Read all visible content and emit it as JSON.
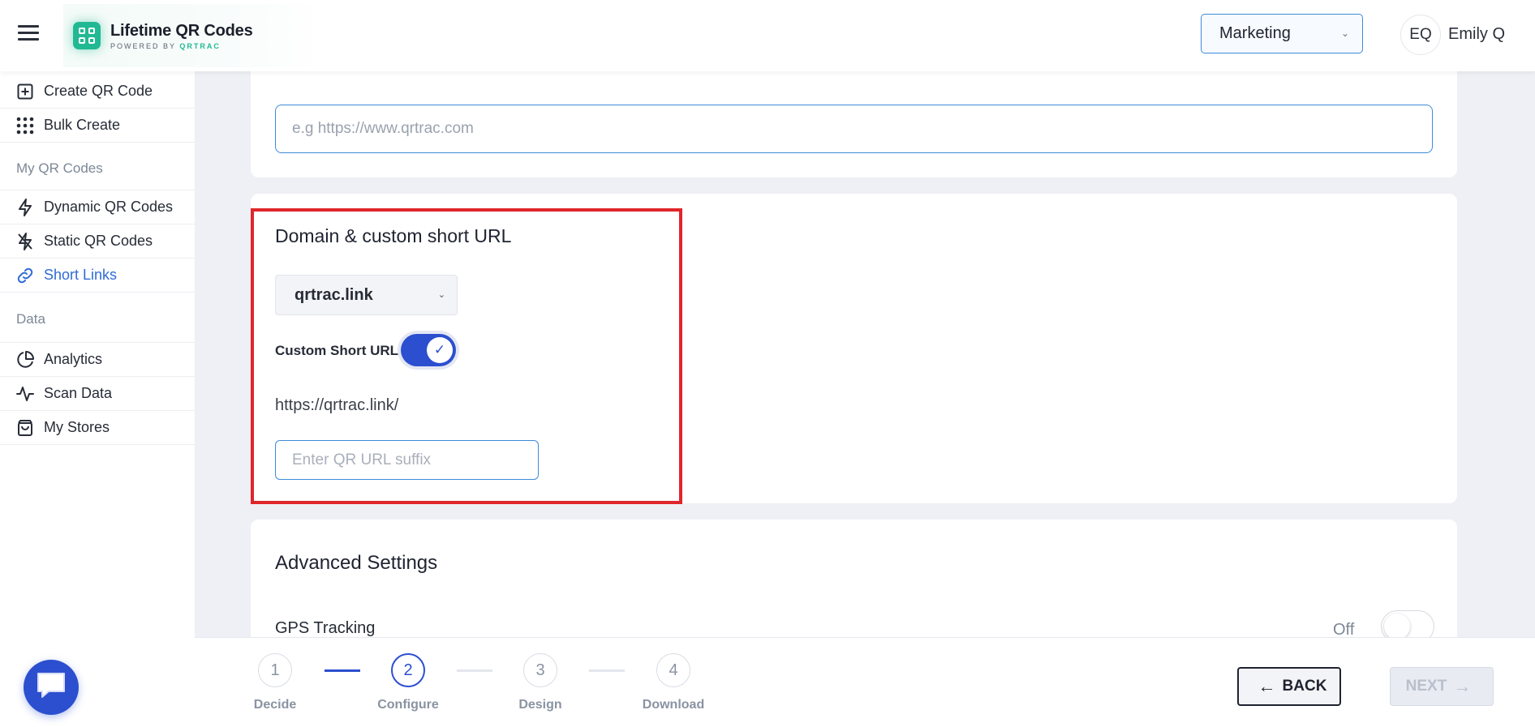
{
  "header": {
    "brand_title": "Lifetime QR Codes",
    "brand_sub_prefix": "POWERED BY",
    "brand_sub_name": "QRTRAC",
    "workspace": "Marketing",
    "avatar_initials": "EQ",
    "username": "Emily Q"
  },
  "sidebar": {
    "items_top": [
      {
        "label": "Create QR Code",
        "icon": "plus-square-icon"
      },
      {
        "label": "Bulk Create",
        "icon": "grid-dots-icon"
      }
    ],
    "section_my_codes": "My QR Codes",
    "items_codes": [
      {
        "label": "Dynamic QR Codes",
        "icon": "lightning-icon"
      },
      {
        "label": "Static QR Codes",
        "icon": "lightning-off-icon"
      },
      {
        "label": "Short Links",
        "icon": "link-icon",
        "active": true
      }
    ],
    "section_data": "Data",
    "items_data": [
      {
        "label": "Analytics",
        "icon": "pie-chart-icon"
      },
      {
        "label": "Scan Data",
        "icon": "activity-icon"
      },
      {
        "label": "My Stores",
        "icon": "shopping-bag-icon"
      }
    ]
  },
  "destination": {
    "placeholder": "e.g https://www.qrtrac.com"
  },
  "domain": {
    "title": "Domain & custom short URL",
    "selected_domain": "qrtrac.link",
    "toggle_label": "Custom Short URL",
    "toggle_on": true,
    "prefix": "https://qrtrac.link/",
    "suffix_placeholder": "Enter QR URL suffix"
  },
  "advanced": {
    "title": "Advanced Settings",
    "gps_label": "GPS Tracking",
    "gps_state": "Off"
  },
  "stepper": {
    "steps": [
      {
        "num": "1",
        "label": "Decide"
      },
      {
        "num": "2",
        "label": "Configure",
        "active": true
      },
      {
        "num": "3",
        "label": "Design"
      },
      {
        "num": "4",
        "label": "Download"
      }
    ],
    "back_label": "BACK",
    "next_label": "NEXT"
  },
  "colors": {
    "primary": "#2c4fcf",
    "link_active": "#2f6bd6",
    "highlight_border": "#e0262b",
    "brand_green": "#21b993"
  }
}
